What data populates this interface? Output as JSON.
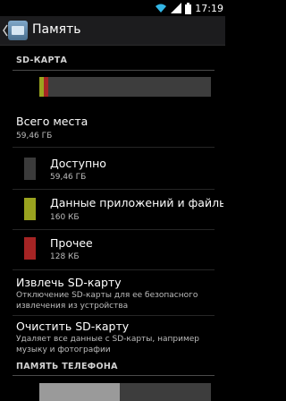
{
  "status_bar": {
    "time": "17:19"
  },
  "action_bar": {
    "title": "Память"
  },
  "sd_section": {
    "header": "SD-КАРТА",
    "usage": {
      "available_fraction": 0.95,
      "apps_fraction": 0.02,
      "other_fraction": 0.02
    },
    "total": {
      "title": "Всего места",
      "value": "59,46 ГБ"
    },
    "items": [
      {
        "label": "Доступно",
        "size": "59,46 ГБ",
        "color": "#3b3b3b"
      },
      {
        "label": "Данные приложений и файлы мультимедиа",
        "size": "160 КБ",
        "color": "#9aa31f"
      },
      {
        "label": "Прочее",
        "size": "128 КБ",
        "color": "#a52424"
      }
    ],
    "unmount": {
      "title": "Извлечь SD-карту",
      "summary_line1": "Отключение SD-карты для ее безопасного",
      "summary_line2": "извлечения из устройства"
    },
    "erase": {
      "title": "Очистить SD-карту",
      "summary_line1": "Удаляет все данные с SD-карты, например",
      "summary_line2": "музыку и фотографии"
    }
  },
  "phone_section": {
    "header": "ПАМЯТЬ ТЕЛЕФОНА",
    "usage": {
      "available_fraction": 0.47
    }
  }
}
